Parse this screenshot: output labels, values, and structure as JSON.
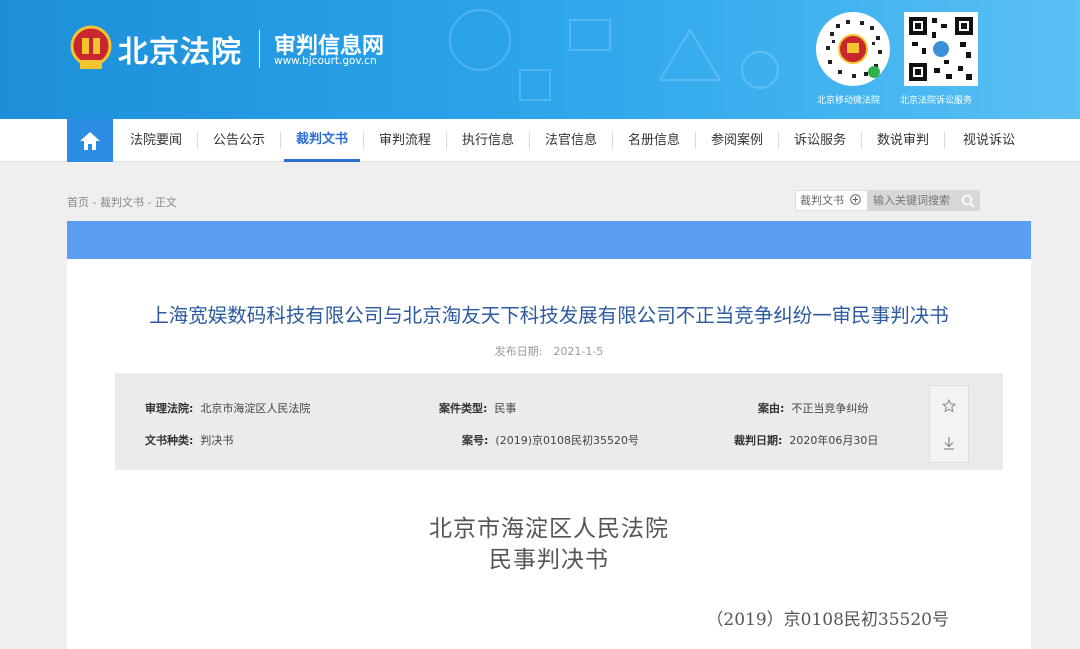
{
  "header": {
    "site_name": "北京法院",
    "sub_name": "审判信息网",
    "url": "www.bjcourt.gov.cn",
    "qr_codes": [
      {
        "label": "北京移动微法院",
        "icon": "mini-program-qr-icon"
      },
      {
        "label": "北京法院诉讼服务",
        "icon": "qr-code-icon"
      }
    ]
  },
  "nav": {
    "home_icon": "home-icon",
    "items": [
      "法院要闻",
      "公告公示",
      "裁判文书",
      "审判流程",
      "执行信息",
      "法官信息",
      "名册信息",
      "参阅案例",
      "诉讼服务",
      "数说审判",
      "视说诉讼"
    ],
    "active": "裁判文书"
  },
  "breadcrumb": "首页 - 裁判文书 - 正文",
  "search": {
    "scope": "裁判文书",
    "placeholder": "输入关键词搜索"
  },
  "document": {
    "title": "上海宽娱数码科技有限公司与北京淘友天下科技发展有限公司不正当竞争纠纷一审民事判决书",
    "publish_date": "发布日期:　2021-1-5",
    "info": {
      "court_label": "审理法院:",
      "court_value": "北京市海淀区人民法院",
      "case_type_label": "案件类型:",
      "case_type_value": "民事",
      "cause_label": "案由:",
      "cause_value": "不正当竞争纠纷",
      "doc_type_label": "文书种类:",
      "doc_type_value": "判决书",
      "case_no_label": "案号:",
      "case_no_value": "(2019)京0108民初35520号",
      "judge_date_label": "裁判日期:",
      "judge_date_value": "2020年06月30日"
    },
    "court_heading": "北京市海淀区人民法院",
    "doc_kind_heading": "民事判决书",
    "case_number_line": "（2019）京0108民初35520号"
  },
  "colors": {
    "header_blue": "#2aa3ea",
    "nav_active": "#2d6fcf",
    "band_blue": "#5b9df0",
    "title_blue": "#2c5aa0"
  }
}
